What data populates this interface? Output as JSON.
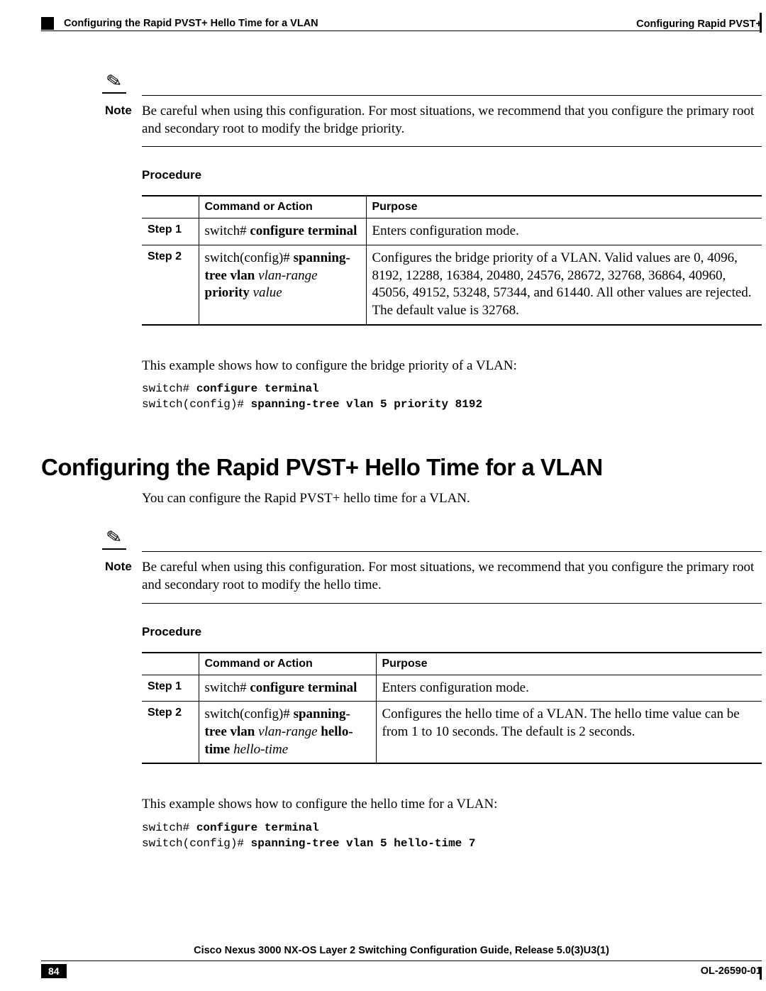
{
  "header": {
    "breadcrumb": "Configuring the Rapid PVST+ Hello Time for a VLAN",
    "chapter": "Configuring Rapid PVST+"
  },
  "note_label": "Note",
  "note1_text": "Be careful when using this configuration. For most situations, we recommend that you configure the primary root and secondary root to modify the bridge priority.",
  "procedure_label": "Procedure",
  "table_headers": {
    "step": "",
    "command": "Command or Action",
    "purpose": "Purpose"
  },
  "table1": {
    "rows": [
      {
        "step": "Step 1",
        "cmd_prefix": "switch# ",
        "cmd_bold": "configure terminal",
        "purpose": "Enters configuration mode."
      },
      {
        "step": "Step 2",
        "cmd_prefix": "switch(config)# ",
        "cmd_bold1": "spanning-tree vlan",
        "cmd_ital1": "vlan-range",
        "cmd_bold2": "priority",
        "cmd_ital2": "value",
        "purpose": "Configures the bridge priority of a VLAN. Valid values are 0, 4096, 8192, 12288, 16384, 20480, 24576, 28672, 32768, 36864, 40960, 45056, 49152, 53248, 57344, and 61440. All other values are rejected. The default value is 32768."
      }
    ]
  },
  "example1_intro": "This example shows how to configure the bridge priority of a VLAN:",
  "example1_code": {
    "l1a": "switch# ",
    "l1b": "configure terminal",
    "l2a": "switch(config)# ",
    "l2b": "spanning-tree vlan 5 priority 8192"
  },
  "section2_title": "Configuring the Rapid PVST+ Hello Time for a VLAN",
  "section2_intro": "You can configure the Rapid PVST+ hello time for a VLAN.",
  "note2_text": "Be careful when using this configuration. For most situations, we recommend that you configure the primary root and secondary root to modify the hello time.",
  "table2": {
    "rows": [
      {
        "step": "Step 1",
        "cmd_prefix": "switch# ",
        "cmd_bold": "configure terminal",
        "purpose": "Enters configuration mode."
      },
      {
        "step": "Step 2",
        "cmd_prefix": "switch(config)# ",
        "cmd_bold1": "spanning-tree vlan",
        "cmd_ital1": "vlan-range",
        "cmd_bold2": "hello-time",
        "cmd_ital2": "hello-time",
        "purpose": "Configures the hello time of a VLAN. The hello time value can be from 1 to 10 seconds. The default is 2 seconds."
      }
    ]
  },
  "example2_intro": "This example shows how to configure the hello time for a VLAN:",
  "example2_code": {
    "l1a": "switch# ",
    "l1b": "configure terminal",
    "l2a": "switch(config)# ",
    "l2b": "spanning-tree vlan 5 hello-time 7"
  },
  "footer": {
    "title": "Cisco Nexus 3000 NX-OS Layer 2 Switching Configuration Guide, Release 5.0(3)U3(1)",
    "page": "84",
    "docnum": "OL-26590-01"
  }
}
